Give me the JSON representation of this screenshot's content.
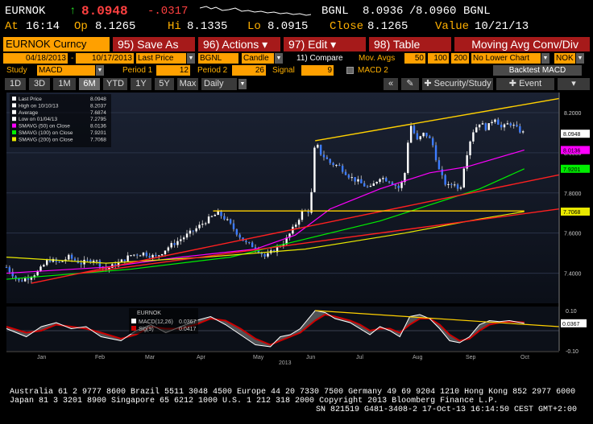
{
  "quote": {
    "ticker": "EURNOK",
    "arrow": "↑",
    "last": "8.0948",
    "change": "-.0317",
    "source": "BGNL",
    "bid": "8.0936",
    "ask": "8.0960",
    "source2": "BGNL",
    "at_label": "At",
    "at_value": "16:14",
    "op_label": "Op",
    "op_value": "8.1265",
    "hi_label": "Hi",
    "hi_value": "8.1335",
    "lo_label": "Lo",
    "lo_value": "8.0915",
    "close_label": "Close",
    "close_value": "8.1265",
    "value_label": "Value",
    "value_value": "10/21/13"
  },
  "menu": {
    "title": "EURNOK Curncy",
    "save": "95) Save As",
    "actions": "96) Actions ▾",
    "edit": "97) Edit ▾",
    "table": "98) Table",
    "study_title": "Moving Avg Conv/Div"
  },
  "params": {
    "start_date": "04/18/2013",
    "dash": "-",
    "end_date": "10/17/2013",
    "price_type": "Last Price",
    "source": "BGNL",
    "chart_type": "Candle",
    "compare": "11) Compare",
    "mov_avgs_label": "Mov. Avgs",
    "mov_avg_1": "50",
    "mov_avg_2": "100",
    "mov_avg_3": "200",
    "lower_chart": "No Lower Chart",
    "currency": "NOK",
    "study_label": "Study",
    "study_value": "MACD",
    "period1_label": "Period 1",
    "period1_value": "12",
    "period2_label": "Period 2",
    "period2_value": "26",
    "signal_label": "Signal",
    "signal_value": "9",
    "macd2_label": "MACD 2",
    "backtest": "Backtest MACD"
  },
  "tabs": {
    "items": [
      "1D",
      "3D",
      "1M",
      "6M",
      "YTD",
      "1Y",
      "5Y",
      "Max"
    ],
    "active": "6M",
    "frequency": "Daily",
    "security_study": "Security/Study",
    "event": "Event"
  },
  "chart_data": [
    {
      "type": "candlestick",
      "yrange": [
        7.25,
        8.3
      ],
      "yticks": [
        "8.2000",
        "8.0000",
        "7.8000",
        "7.6000",
        "7.4000"
      ],
      "xticks": [
        "Jan",
        "Feb",
        "Mar",
        "Apr",
        "May",
        "Jun",
        "Jul",
        "Aug",
        "Sep",
        "Oct"
      ],
      "year_label": "2013",
      "price_path": [
        [
          0,
          7.43
        ],
        [
          5,
          7.36
        ],
        [
          9,
          7.38
        ],
        [
          13,
          7.41
        ],
        [
          17,
          7.47
        ],
        [
          21,
          7.45
        ],
        [
          25,
          7.48
        ],
        [
          30,
          7.45
        ],
        [
          35,
          7.47
        ],
        [
          40,
          7.42
        ],
        [
          45,
          7.45
        ],
        [
          50,
          7.49
        ],
        [
          55,
          7.5
        ],
        [
          60,
          7.48
        ],
        [
          65,
          7.53
        ],
        [
          70,
          7.57
        ],
        [
          75,
          7.61
        ],
        [
          80,
          7.66
        ],
        [
          85,
          7.7
        ],
        [
          88,
          7.67
        ],
        [
          92,
          7.61
        ],
        [
          96,
          7.55
        ],
        [
          100,
          7.53
        ],
        [
          104,
          7.48
        ],
        [
          108,
          7.52
        ],
        [
          112,
          7.56
        ],
        [
          116,
          7.64
        ],
        [
          119,
          7.71
        ],
        [
          122,
          7.71
        ],
        [
          124,
          8.06
        ],
        [
          126,
          8.0
        ],
        [
          130,
          7.95
        ],
        [
          134,
          7.93
        ],
        [
          138,
          7.88
        ],
        [
          142,
          7.85
        ],
        [
          146,
          7.82
        ],
        [
          150,
          7.88
        ],
        [
          154,
          7.86
        ],
        [
          158,
          7.82
        ],
        [
          160,
          7.9
        ],
        [
          162,
          8.15
        ],
        [
          165,
          8.06
        ],
        [
          168,
          8.1
        ],
        [
          171,
          8.05
        ],
        [
          174,
          7.9
        ],
        [
          177,
          7.83
        ],
        [
          180,
          7.85
        ],
        [
          182,
          7.8
        ],
        [
          184,
          7.95
        ],
        [
          187,
          8.1
        ],
        [
          190,
          8.15
        ],
        [
          193,
          8.12
        ],
        [
          196,
          8.18
        ],
        [
          199,
          8.12
        ],
        [
          202,
          8.15
        ],
        [
          205,
          8.12
        ],
        [
          208,
          8.0948
        ]
      ],
      "moving_averages": [
        {
          "name": "SMAVG (50) on Close",
          "value": "8.0136",
          "color": "#ff00ff",
          "points": [
            [
              0,
              7.4
            ],
            [
              40,
              7.43
            ],
            [
              70,
              7.48
            ],
            [
              100,
              7.52
            ],
            [
              116,
              7.59
            ],
            [
              130,
              7.72
            ],
            [
              150,
              7.82
            ],
            [
              170,
              7.9
            ],
            [
              185,
              7.93
            ],
            [
              208,
              8.0136
            ]
          ]
        },
        {
          "name": "SMAVG (100) on Close",
          "value": "7.9201",
          "color": "#00ee00",
          "points": [
            [
              0,
              7.37
            ],
            [
              50,
              7.42
            ],
            [
              90,
              7.48
            ],
            [
              120,
              7.57
            ],
            [
              150,
              7.66
            ],
            [
              170,
              7.74
            ],
            [
              190,
              7.82
            ],
            [
              208,
              7.92
            ]
          ]
        },
        {
          "name": "SMAVG (200) on Close",
          "value": "7.7068",
          "color": "#e8e800",
          "points": [
            [
              0,
              7.48
            ],
            [
              40,
              7.45
            ],
            [
              80,
              7.48
            ],
            [
              120,
              7.52
            ],
            [
              160,
              7.6
            ],
            [
              190,
              7.67
            ],
            [
              208,
              7.7068
            ]
          ]
        }
      ],
      "trendlines": [
        {
          "color": "#ff2020",
          "points": [
            [
              10,
              7.35
            ],
            [
              222,
              7.89
            ]
          ]
        },
        {
          "color": "#ff2020",
          "points": [
            [
              30,
              7.4
            ],
            [
              222,
              7.72
            ]
          ]
        },
        {
          "color": "#ffd000",
          "points": [
            [
              124,
              8.06
            ],
            [
              222,
              8.27
            ]
          ]
        },
        {
          "color": "#ffd000",
          "points": [
            [
              83,
              7.71
            ],
            [
              208,
              7.71
            ]
          ]
        }
      ],
      "legend": [
        {
          "label": "Last Price",
          "value": "8.0948",
          "color": "#ffffff"
        },
        {
          "label": "High on 10/10/13",
          "value": "8.2037",
          "color": "#ffffff"
        },
        {
          "label": "Average",
          "value": "7.6874",
          "color": "#ffffff"
        },
        {
          "label": "Low on 01/04/13",
          "value": "7.2795",
          "color": "#ffffff"
        },
        {
          "label": "SMAVG (50) on Close",
          "value": "8.0136",
          "color": "#ff00ff"
        },
        {
          "label": "SMAVG (100) on Close",
          "value": "7.9201",
          "color": "#00ee00"
        },
        {
          "label": "SMAVG (200) on Close",
          "value": "7.7068",
          "color": "#e8e800"
        }
      ],
      "right_labels": [
        {
          "value": "8.0948",
          "color": "#ffffff",
          "text": "#000000"
        },
        {
          "value": "8.0136",
          "color": "#ff00ff",
          "text": "#000000"
        },
        {
          "value": "7.9201",
          "color": "#00ee00",
          "text": "#000000"
        },
        {
          "value": "7.7068",
          "color": "#e8e800",
          "text": "#000000"
        }
      ]
    },
    {
      "type": "area",
      "title": "EURNOK",
      "yrange": [
        -0.1,
        0.12
      ],
      "yticks": [
        "0.10",
        "-0.10"
      ],
      "series": [
        {
          "name": "MACD(12,26)",
          "value": "0.0367",
          "color": "#ffffff",
          "points": [
            [
              0,
              0.01
            ],
            [
              8,
              -0.03
            ],
            [
              14,
              0.02
            ],
            [
              20,
              0.04
            ],
            [
              26,
              0.01
            ],
            [
              32,
              0.02
            ],
            [
              38,
              -0.03
            ],
            [
              46,
              -0.05
            ],
            [
              52,
              0.0
            ],
            [
              58,
              0.03
            ],
            [
              64,
              -0.01
            ],
            [
              70,
              0.02
            ],
            [
              76,
              0.05
            ],
            [
              82,
              0.07
            ],
            [
              88,
              0.03
            ],
            [
              94,
              -0.02
            ],
            [
              100,
              -0.07
            ],
            [
              106,
              -0.08
            ],
            [
              110,
              -0.03
            ],
            [
              114,
              -0.02
            ],
            [
              118,
              0.01
            ],
            [
              124,
              0.1
            ],
            [
              128,
              0.09
            ],
            [
              132,
              0.06
            ],
            [
              138,
              0.04
            ],
            [
              142,
              0.01
            ],
            [
              146,
              -0.02
            ],
            [
              150,
              0.02
            ],
            [
              154,
              0.0
            ],
            [
              158,
              -0.03
            ],
            [
              162,
              0.07
            ],
            [
              166,
              0.08
            ],
            [
              170,
              0.06
            ],
            [
              174,
              0.01
            ],
            [
              178,
              -0.05
            ],
            [
              182,
              -0.06
            ],
            [
              186,
              -0.03
            ],
            [
              190,
              0.03
            ],
            [
              194,
              0.05
            ],
            [
              198,
              0.045
            ],
            [
              202,
              0.05
            ],
            [
              208,
              0.0367
            ]
          ]
        },
        {
          "name": "Sig(9)",
          "value": "0.0417",
          "color": "#cc0000",
          "points": [
            [
              0,
              0.02
            ],
            [
              8,
              -0.01
            ],
            [
              14,
              0.0
            ],
            [
              20,
              0.03
            ],
            [
              26,
              0.02
            ],
            [
              32,
              0.01
            ],
            [
              38,
              -0.01
            ],
            [
              46,
              -0.04
            ],
            [
              52,
              -0.02
            ],
            [
              58,
              0.02
            ],
            [
              64,
              0.01
            ],
            [
              70,
              0.01
            ],
            [
              76,
              0.03
            ],
            [
              82,
              0.06
            ],
            [
              88,
              0.05
            ],
            [
              94,
              0.01
            ],
            [
              100,
              -0.04
            ],
            [
              106,
              -0.07
            ],
            [
              110,
              -0.05
            ],
            [
              114,
              -0.03
            ],
            [
              118,
              -0.01
            ],
            [
              124,
              0.05
            ],
            [
              128,
              0.08
            ],
            [
              132,
              0.07
            ],
            [
              138,
              0.05
            ],
            [
              142,
              0.03
            ],
            [
              146,
              0.0
            ],
            [
              150,
              0.01
            ],
            [
              154,
              0.01
            ],
            [
              158,
              -0.01
            ],
            [
              162,
              0.03
            ],
            [
              166,
              0.06
            ],
            [
              170,
              0.06
            ],
            [
              174,
              0.03
            ],
            [
              178,
              -0.02
            ],
            [
              182,
              -0.05
            ],
            [
              186,
              -0.04
            ],
            [
              190,
              0.0
            ],
            [
              194,
              0.03
            ],
            [
              198,
              0.04
            ],
            [
              202,
              0.045
            ],
            [
              208,
              0.0417
            ]
          ]
        }
      ],
      "trendline": {
        "color": "#ffd000",
        "points": [
          [
            124,
            0.1
          ],
          [
            222,
            0.02
          ]
        ]
      },
      "right_labels": [
        {
          "value": "0.0367",
          "color": "#ffffff"
        }
      ]
    }
  ],
  "footer": {
    "line1": "Australia 61 2 9777 8600 Brazil 5511 3048 4500 Europe 44 20 7330 7500 Germany 49 69 9204 1210 Hong Kong 852 2977 6000",
    "line2": "Japan 81 3 3201 8900       Singapore 65 6212 1000      U.S. 1 212 318 2000        Copyright 2013 Bloomberg Finance L.P.",
    "line3": "SN 821519 G481-3408-2 17-Oct-13 16:14:50 CEST GMT+2:00"
  },
  "colors": {
    "amber": "#ffb000",
    "menu_red": "#a61a1a",
    "field": "#ffa000",
    "up": "#ffffff",
    "down": "#3d7cff"
  }
}
